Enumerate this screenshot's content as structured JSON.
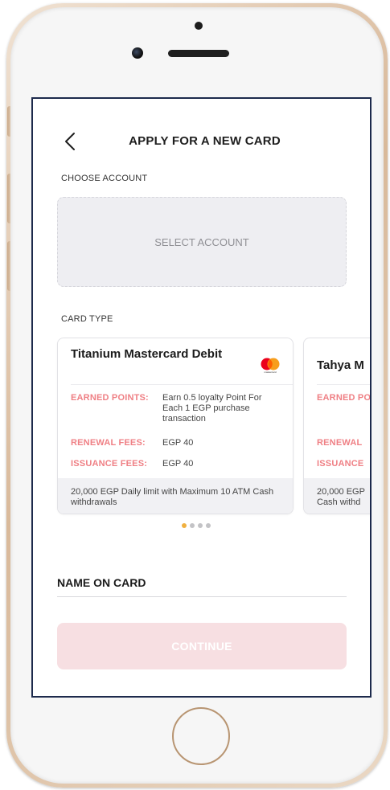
{
  "header": {
    "title": "APPLY FOR A NEW CARD",
    "back_icon": "chevron-left-icon"
  },
  "account": {
    "section_label": "CHOOSE ACCOUNT",
    "select_label": "SELECT ACCOUNT"
  },
  "card_type": {
    "section_label": "CARD TYPE",
    "cards": [
      {
        "name": "Titanium Mastercard Debit",
        "logo": "mastercard-logo",
        "logo_text": "mastercard",
        "earned_points_label": "EARNED POINTS:",
        "earned_points_value": "Earn 0.5 loyalty Point For Each 1 EGP purchase transaction",
        "renewal_fees_label": "RENEWAL FEES:",
        "renewal_fees_value": "EGP 40",
        "issuance_fees_label": "ISSUANCE FEES:",
        "issuance_fees_value": "EGP 40",
        "footer": "20,000 EGP Daily limit with Maximum 10 ATM Cash withdrawals"
      },
      {
        "name": "Tahya M",
        "earned_points_label": "EARNED PO",
        "renewal_fees_label": "RENEWAL",
        "issuance_fees_label": "ISSUANCE",
        "footer": "20,000 EGP\nCash withd"
      }
    ],
    "pagination": {
      "count": 4,
      "active_index": 0
    }
  },
  "name_on_card": {
    "label": "NAME ON CARD",
    "value": ""
  },
  "continue_label": "CONTINUE",
  "colors": {
    "accent_pink": "#ef7f84",
    "continue_bg": "#f7dfe2",
    "active_dot": "#f0b040",
    "screen_border": "#1d2a4c",
    "mastercard_red": "#eb001b",
    "mastercard_orange": "#f79e1b"
  }
}
